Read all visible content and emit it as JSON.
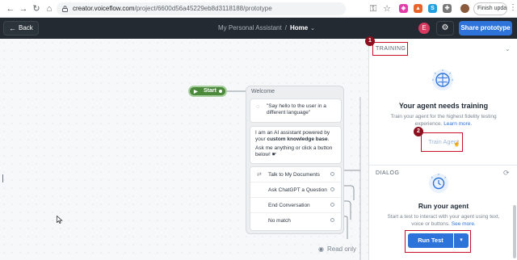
{
  "browser": {
    "url_host": "creator.voiceflow.com",
    "url_path": "/project/6600d56a45229eb8d3118188/prototype",
    "finish_update_label": "Finish update"
  },
  "header": {
    "back_label": "Back",
    "project_name": "My Personal Assistant",
    "separator": "/",
    "current_page": "Home",
    "avatar_initial": "E",
    "share_label": "Share prototype"
  },
  "canvas": {
    "start_label": "Start",
    "block_title": "Welcome",
    "speak_text": "\"Say hello to the user in a different language\"",
    "ai_text_1": "I am an AI assistant powered by your",
    "ai_text_bold": "custom knowledge base",
    "ai_text_2": "Ask me anything or click a button below!",
    "choices": [
      {
        "label": "Talk to My Documents"
      },
      {
        "label": "Ask ChatGPT a Question"
      },
      {
        "label": "End Conversation"
      },
      {
        "label": "No match"
      }
    ],
    "read_only_label": "Read only"
  },
  "panel": {
    "training_label": "TRAINING",
    "train_title": "Your agent needs training",
    "train_desc": "Train your agent for the highest fidelity testing experience.",
    "learn_more": "Learn more.",
    "train_button": "Train Agent",
    "dialog_label": "DIALOG",
    "run_title": "Run your agent",
    "run_desc": "Start a test to interact with your agent using text, voice or buttons.",
    "see_more": "See more.",
    "run_button": "Run Test"
  },
  "annotations": {
    "one": "1",
    "two": "2"
  },
  "colors": {
    "accent": "#2d73d9",
    "header_bg": "#232a31",
    "start_node": "#4b8a3a",
    "annotation": "#c8102e"
  }
}
